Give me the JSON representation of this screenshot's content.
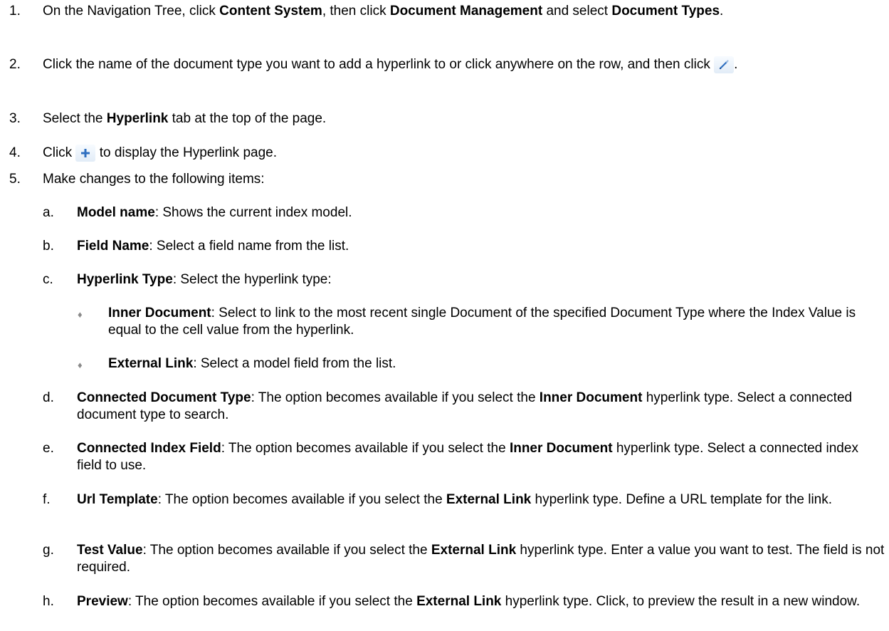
{
  "steps": [
    {
      "n": "1.",
      "parts": [
        {
          "t": "On the Navigation Tree, click "
        },
        {
          "t": "Content System",
          "b": true
        },
        {
          "t": ", then click "
        },
        {
          "t": "Document Management",
          "b": true
        },
        {
          "t": " and select "
        },
        {
          "t": "Document Types",
          "b": true
        },
        {
          "t": "."
        }
      ]
    },
    {
      "n": "2.",
      "parts": [
        {
          "t": "Click the name of the document type you want to add a hyperlink to or click anywhere on the row, and then click "
        },
        {
          "icon": "pencil-icon"
        },
        {
          "t": "."
        }
      ]
    },
    {
      "n": "3.",
      "parts": [
        {
          "t": "Select the "
        },
        {
          "t": "Hyperlink",
          "b": true
        },
        {
          "t": " tab at the top of the page."
        }
      ]
    },
    {
      "n": "4.",
      "parts": [
        {
          "t": "Click "
        },
        {
          "icon": "plus-icon"
        },
        {
          "t": " to display the Hyperlink page."
        }
      ]
    },
    {
      "n": "5.",
      "parts": [
        {
          "t": "Make changes to  the following items:"
        }
      ]
    }
  ],
  "items": [
    {
      "n": "a.",
      "parts": [
        {
          "t": "Model name",
          "b": true
        },
        {
          "t": ": Shows the current index model."
        }
      ]
    },
    {
      "n": "b.",
      "parts": [
        {
          "t": "Field Name",
          "b": true
        },
        {
          "t": ": Select a field name from the list."
        }
      ]
    },
    {
      "n": "c.",
      "parts": [
        {
          "t": "Hyperlink Type",
          "b": true
        },
        {
          "t": ": Select the hyperlink type:"
        }
      ]
    },
    {
      "n": "d.",
      "parts": [
        {
          "t": "Connected Document Type",
          "b": true
        },
        {
          "t": ": The option becomes available if you select the "
        },
        {
          "t": "Inner Document",
          "b": true
        },
        {
          "t": " hyperlink type. Select a connected document type to search."
        }
      ]
    },
    {
      "n": "e.",
      "parts": [
        {
          "t": "Connected Index Field",
          "b": true
        },
        {
          "t": ": The option becomes available if you select the "
        },
        {
          "t": "Inner Document",
          "b": true
        },
        {
          "t": " hyperlink type. Select a connected index field to use."
        }
      ]
    },
    {
      "n": "f.",
      "parts": [
        {
          "t": "Url Template",
          "b": true
        },
        {
          "t": ": The option becomes available if you select the "
        },
        {
          "t": "External Link",
          "b": true
        },
        {
          "t": " hyperlink type. Define a URL template for the link."
        }
      ]
    },
    {
      "n": "g.",
      "parts": [
        {
          "t": "Test Value",
          "b": true
        },
        {
          "t": ": The option becomes available if you select the "
        },
        {
          "t": "External Link",
          "b": true
        },
        {
          "t": " hyperlink type. Enter a value you want to test. The field is not required."
        }
      ]
    },
    {
      "n": "h.",
      "parts": [
        {
          "t": "Preview",
          "b": true
        },
        {
          "t": ": The option becomes available if you select the "
        },
        {
          "t": "External Link",
          "b": true
        },
        {
          "t": " hyperlink type. Click, to preview the result in a new window."
        }
      ]
    }
  ],
  "bullets": [
    {
      "n": "♦",
      "parts": [
        {
          "t": "Inner Document",
          "b": true
        },
        {
          "t": ": Select to link to the most recent single Document of the specified Document Type where the Index Value is equal to the cell value from the hyperlink."
        }
      ]
    },
    {
      "n": "♦",
      "parts": [
        {
          "t": "External Link",
          "b": true
        },
        {
          "t": ": Select a model field from the list."
        }
      ]
    }
  ],
  "colors": {
    "text": "#000000",
    "bullet": "#8a8a8a",
    "icon_blue": "#2f6fc0",
    "icon_bg": "#e8f0f9"
  }
}
